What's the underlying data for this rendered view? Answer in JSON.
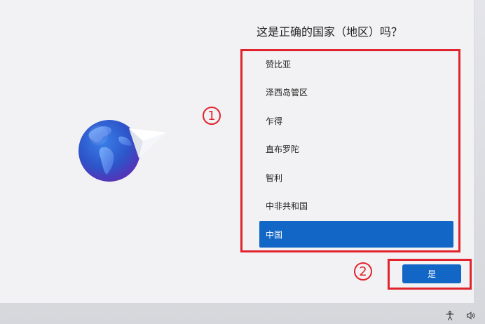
{
  "page": {
    "title": "这是正确的国家（地区）吗？"
  },
  "countries": [
    {
      "label": "赞比亚",
      "selected": false
    },
    {
      "label": "泽西岛管区",
      "selected": false
    },
    {
      "label": "乍得",
      "selected": false
    },
    {
      "label": "直布罗陀",
      "selected": false
    },
    {
      "label": "智利",
      "selected": false
    },
    {
      "label": "中非共和国",
      "selected": false
    },
    {
      "label": "中国",
      "selected": true
    }
  ],
  "actions": {
    "yes_label": "是"
  },
  "annotations": {
    "step1": "1",
    "step2": "2"
  },
  "colors": {
    "accent": "#1166c6",
    "annotation": "#e0242d"
  },
  "icons": {
    "illustration": "globe-with-paper-plane",
    "tray_left": "accessibility-icon",
    "tray_right": "volume-icon"
  }
}
